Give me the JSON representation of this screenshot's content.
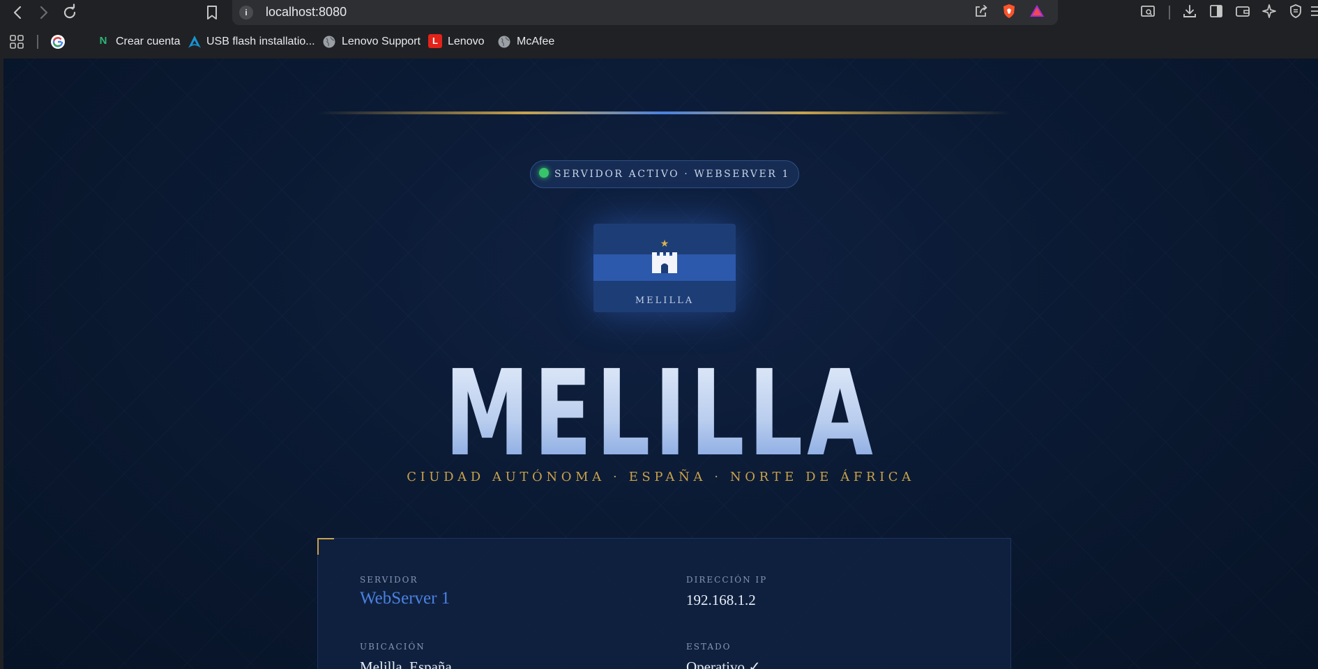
{
  "browser": {
    "url": "localhost:8080",
    "bookmarks": [
      {
        "label": "Crear cuenta",
        "icon": "N"
      },
      {
        "label": "USB flash installatio...",
        "icon": "arch-icon"
      },
      {
        "label": "Lenovo Support",
        "icon": "globe-icon"
      },
      {
        "label": "Lenovo",
        "icon": "L"
      },
      {
        "label": "McAfee",
        "icon": "globe-icon"
      }
    ]
  },
  "page": {
    "status_text": "SERVIDOR ACTIVO · WEBSERVER 1",
    "emblem_label": "MELILLA",
    "title": "MELILLA",
    "subtitle": "CIUDAD AUTÓNOMA · ESPAÑA · NORTE DE ÁFRICA",
    "info": {
      "server_label": "SERVIDOR",
      "server_value": "WebServer 1",
      "ip_label": "DIRECCIÓN IP",
      "ip_value": "192.168.1.2",
      "location_label": "UBICACIÓN",
      "location_value": "Melilla, España",
      "status_label": "ESTADO",
      "status_value": "Operativo ✓"
    }
  },
  "colors": {
    "accent_gold": "#c9a24b",
    "accent_blue": "#4a82e0",
    "status_green": "#37c46a",
    "background": "#0b1a33"
  }
}
